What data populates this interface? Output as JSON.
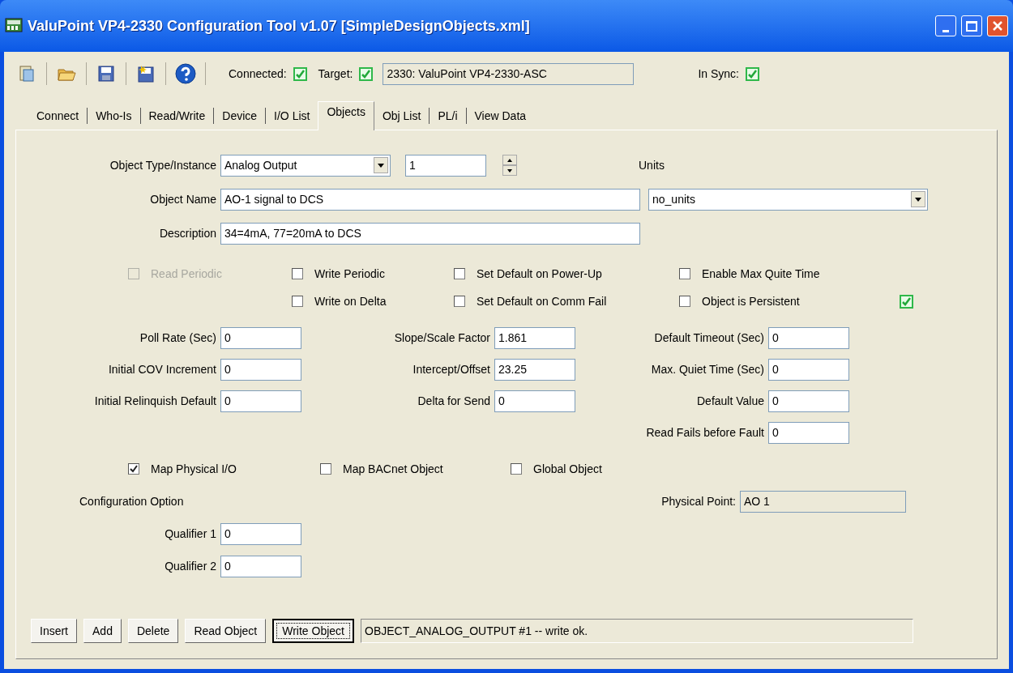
{
  "window": {
    "title": "ValuPoint VP4-2330 Configuration Tool v1.07 [SimpleDesignObjects.xml]"
  },
  "toolbar": {
    "connected": {
      "label": "Connected:",
      "checked": true
    },
    "target": {
      "label": "Target:",
      "checked": true,
      "value": "2330: ValuPoint VP4-2330-ASC"
    },
    "in_sync": {
      "label": "In Sync:",
      "checked": true
    }
  },
  "tabs": [
    {
      "label": "Connect",
      "selected": false
    },
    {
      "label": "Who-Is",
      "selected": false
    },
    {
      "label": "Read/Write",
      "selected": false
    },
    {
      "label": "Device",
      "selected": false
    },
    {
      "label": "I/O List",
      "selected": false
    },
    {
      "label": "Objects",
      "selected": true
    },
    {
      "label": "Obj List",
      "selected": false
    },
    {
      "label": "PL/i",
      "selected": false
    },
    {
      "label": "View Data",
      "selected": false
    }
  ],
  "form": {
    "object_type": {
      "label": "Object Type/Instance",
      "value": "Analog Output"
    },
    "instance": "1",
    "units": {
      "label": "Units",
      "value": "no_units"
    },
    "object_name": {
      "label": "Object Name",
      "value": "AO-1 signal to DCS"
    },
    "description": {
      "label": "Description",
      "value": "34=4mA, 77=20mA to DCS"
    },
    "options": [
      [
        {
          "label": "Read Periodic",
          "checked": false,
          "disabled": true
        },
        {
          "label": "Write Periodic",
          "checked": false,
          "disabled": false
        },
        {
          "label": "Set Default on Power-Up",
          "checked": false,
          "disabled": false
        },
        {
          "label": "Enable Max Quite Time",
          "checked": false,
          "disabled": false
        }
      ],
      [
        {
          "label": "Write on Delta",
          "checked": false,
          "disabled": false
        },
        {
          "label": "Set Default on Comm Fail",
          "checked": false,
          "disabled": false
        },
        {
          "label": "Object is Persistent",
          "checked": false,
          "disabled": false
        }
      ]
    ],
    "status_indicator": {
      "checked": true
    },
    "field_columns": [
      [
        {
          "label": "Poll Rate (Sec)",
          "value": "0"
        },
        {
          "label": "Initial COV Increment",
          "value": "0"
        },
        {
          "label": "Initial Relinquish Default",
          "value": "0"
        }
      ],
      [
        {
          "label": "Slope/Scale Factor",
          "value": "1.861"
        },
        {
          "label": "Intercept/Offset",
          "value": "23.25"
        },
        {
          "label": "Delta for Send",
          "value": "0"
        }
      ],
      [
        {
          "label": "Default Timeout (Sec)",
          "value": "0"
        },
        {
          "label": "Max. Quiet Time (Sec)",
          "value": "0"
        },
        {
          "label": "Default Value",
          "value": "0"
        },
        {
          "label": "Read Fails before Fault",
          "value": "0"
        }
      ]
    ],
    "mapping": [
      {
        "label": "Map Physical I/O",
        "checked": true
      },
      {
        "label": "Map BACnet Object",
        "checked": false
      },
      {
        "label": "Global Object",
        "checked": false
      }
    ],
    "configuration_option": "Configuration Option",
    "physical_point": {
      "label": "Physical Point:",
      "value": "AO 1"
    },
    "qualifiers": [
      {
        "label": "Qualifier 1",
        "value": "0"
      },
      {
        "label": "Qualifier 2",
        "value": "0"
      }
    ]
  },
  "buttons": [
    {
      "label": "Insert",
      "focused": false
    },
    {
      "label": "Add",
      "focused": false
    },
    {
      "label": "Delete",
      "focused": false
    },
    {
      "label": "Read Object",
      "focused": false
    },
    {
      "label": "Write Object",
      "focused": true
    }
  ],
  "status_message": "OBJECT_ANALOG_OUTPUT #1 -- write ok."
}
